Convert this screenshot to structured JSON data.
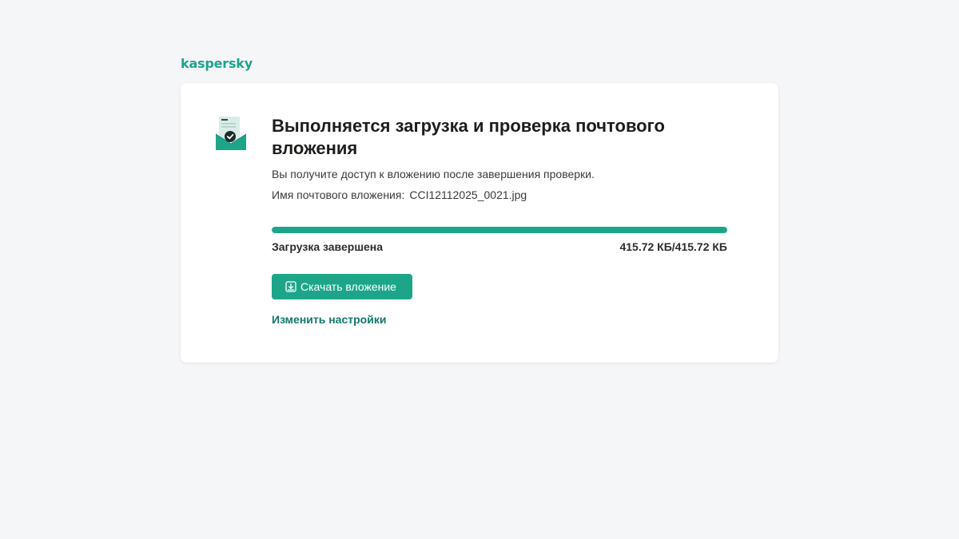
{
  "brand": {
    "logo_text": "kaspersky",
    "accent_color": "#1da58a"
  },
  "card": {
    "icon": "mail-attachment-check-icon",
    "title": "Выполняется загрузка и проверка почтового вложения",
    "subtitle": "Вы получите доступ к вложению после завершения проверки.",
    "file_label": "Имя почтового вложения:",
    "file_name": "CCI12112025_0021.jpg",
    "progress": {
      "fraction": 1.0,
      "status": "Загрузка завершена",
      "size_text": "415.72 КБ/415.72 КБ"
    },
    "download_button": {
      "label": "Скачать вложение",
      "icon": "download-icon"
    },
    "settings_link": "Изменить настройки"
  }
}
